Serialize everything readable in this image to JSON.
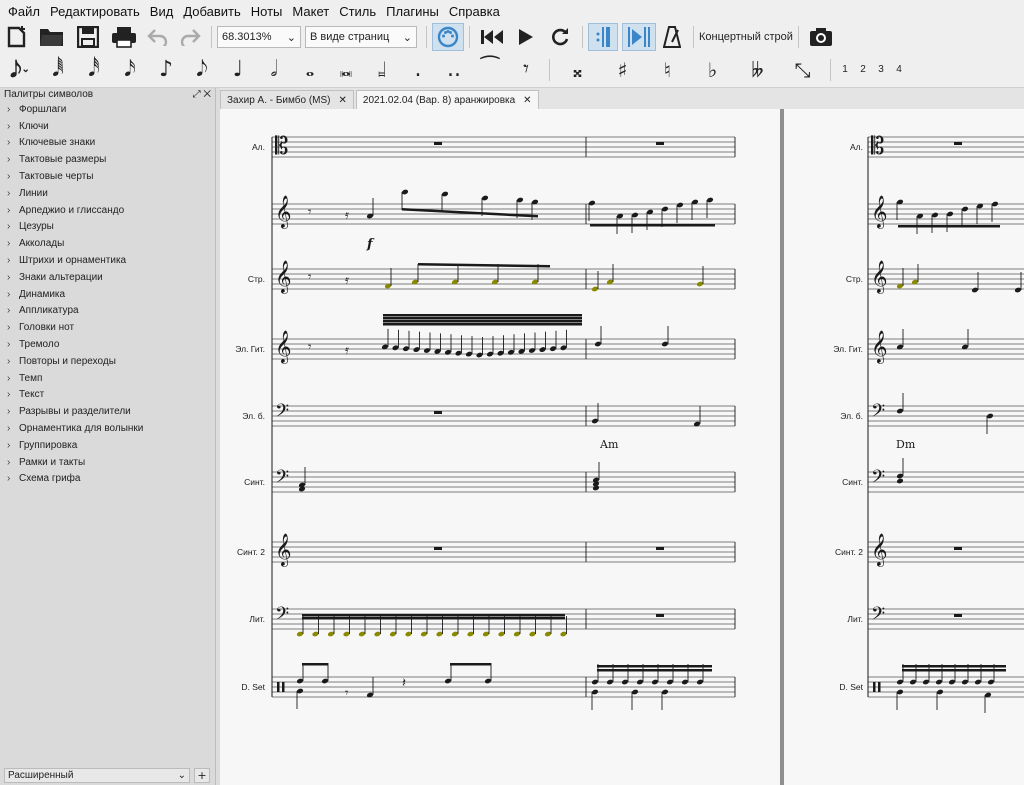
{
  "menu": [
    "Файл",
    "Редактировать",
    "Вид",
    "Добавить",
    "Ноты",
    "Макет",
    "Стиль",
    "Плагины",
    "Справка"
  ],
  "toolbar": {
    "zoom": "68.3013%",
    "view_mode": "В виде страниц",
    "concert_pitch": "Концертный строй"
  },
  "note_input": {
    "accidentals": [
      "𝄪",
      "♯",
      "♮",
      "♭",
      "𝄫"
    ],
    "voices": [
      "1",
      "2",
      "3",
      "4"
    ]
  },
  "palette": {
    "title": "Палитры символов",
    "items": [
      "Форшлаги",
      "Ключи",
      "Ключевые знаки",
      "Тактовые размеры",
      "Тактовые черты",
      "Линии",
      "Арпеджио и глиссандо",
      "Цезуры",
      "Акколады",
      "Штрихи и орнаментика",
      "Знаки альтерации",
      "Динамика",
      "Аппликатура",
      "Головки нот",
      "Тремоло",
      "Повторы и переходы",
      "Темп",
      "Текст",
      "Разрывы и разделители",
      "Орнаментика для волынки",
      "Группировка",
      "Рамки и такты",
      "Схема грифа"
    ],
    "workspace": "Расширенный",
    "add": "+"
  },
  "tabs": [
    {
      "label": "Захир А. - Бимбо (MS)",
      "close": "✕"
    },
    {
      "label": "2021.02.04 (Вар. 8) аранжировка",
      "close": "✕"
    }
  ],
  "score": {
    "staves": [
      {
        "name": "Ал.",
        "clef": "alto"
      },
      {
        "name": "",
        "clef": "treble"
      },
      {
        "name": "Стр.",
        "clef": "treble"
      },
      {
        "name": "Эл. Гит.",
        "clef": "treble"
      },
      {
        "name": "Эл. б.",
        "clef": "bass"
      },
      {
        "name": "Синт.",
        "clef": "bass"
      },
      {
        "name": "Синт. 2",
        "clef": "treble"
      },
      {
        "name": "Лит.",
        "clef": "bass"
      },
      {
        "name": "D. Set",
        "clef": "percussion"
      }
    ],
    "dynamic": "f",
    "chords": [
      "Am",
      "Dm"
    ]
  },
  "colors": {
    "accent": "#3a86c8",
    "selected_note": "#8a8a00"
  }
}
